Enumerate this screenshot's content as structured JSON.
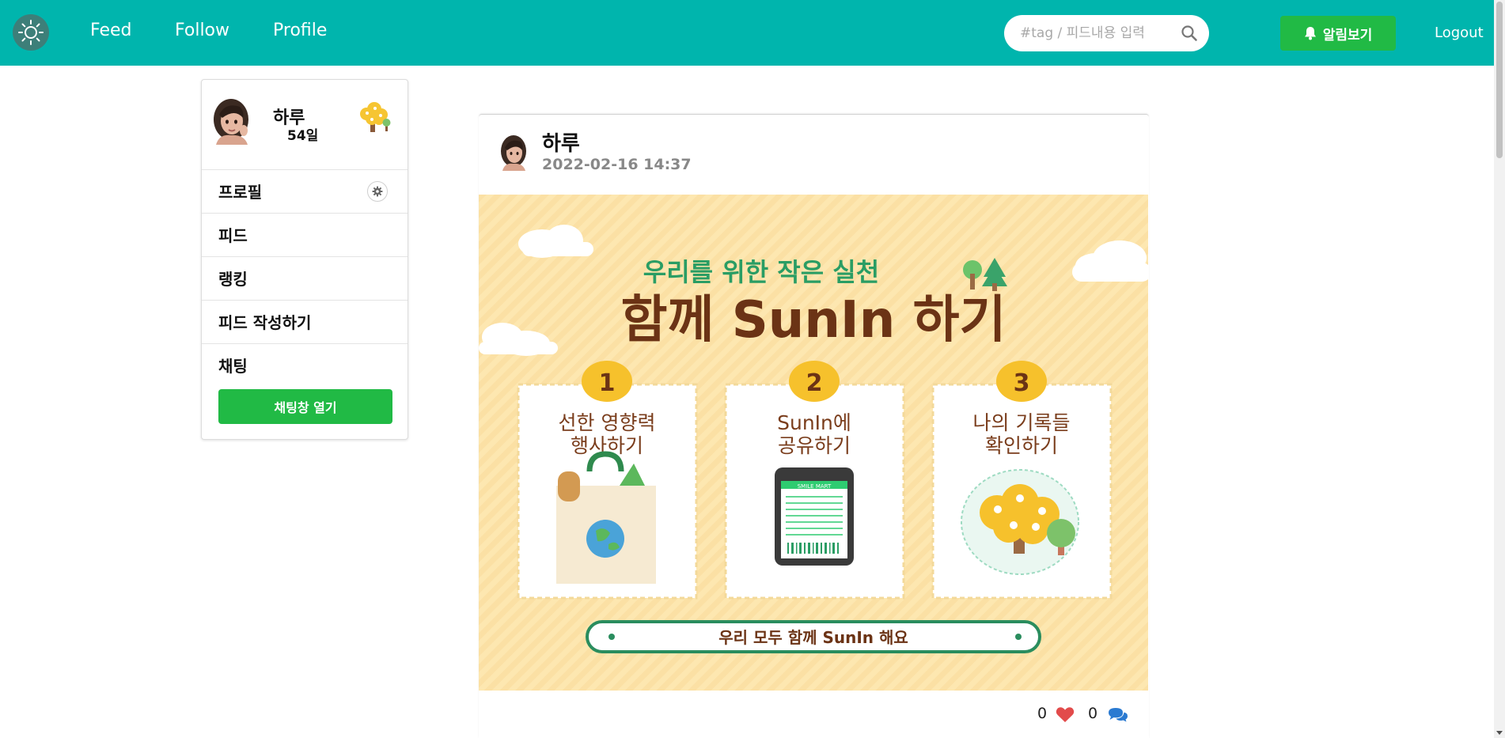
{
  "nav": {
    "links": [
      "Feed",
      "Follow",
      "Profile"
    ],
    "search_placeholder": "#tag / 피드내용 입력",
    "alarm_label": "알림보기",
    "logout_label": "Logout",
    "colors": {
      "navbar": "#00b5ad",
      "button": "#21ba45"
    }
  },
  "sidebar": {
    "user_name": "하루",
    "days": "54일",
    "items": [
      "프로필",
      "피드",
      "랭킹",
      "피드 작성하기",
      "채팅"
    ],
    "chat_button": "채팅창 열기"
  },
  "post": {
    "author": "하루",
    "date": "2022-02-16 14:37",
    "image": {
      "subtitle": "우리를 위한 작은 실천",
      "title": "함께 SunIn 하기",
      "steps": [
        {
          "num": "1",
          "line1": "선한 영향력",
          "line2": "행사하기"
        },
        {
          "num": "2",
          "line1": "SunIn에",
          "line2": "공유하기"
        },
        {
          "num": "3",
          "line1": "나의 기록들",
          "line2": "확인하기"
        }
      ],
      "receipt_header": "SMILE MART",
      "banner": "우리 모두 함께 SunIn 해요"
    },
    "likes": "0",
    "comments": "0"
  }
}
